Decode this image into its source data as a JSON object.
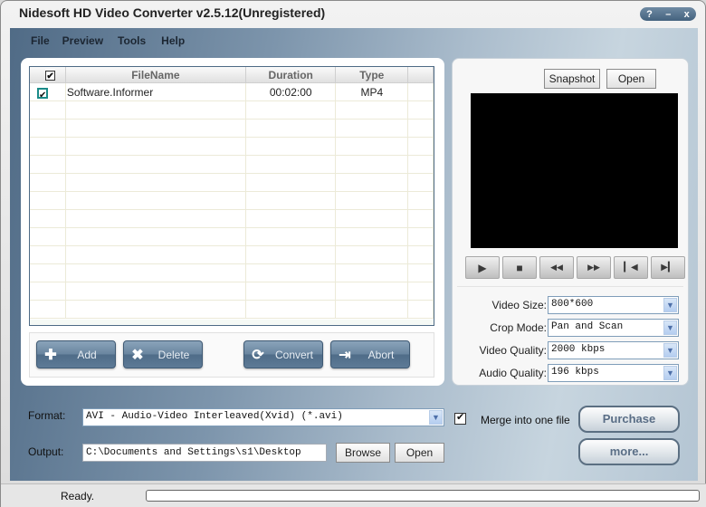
{
  "window": {
    "title": "Nidesoft HD Video Converter v2.5.12(Unregistered)",
    "controls": [
      {
        "name": "help-button",
        "label": "?"
      },
      {
        "name": "minimize-button",
        "label": "–"
      },
      {
        "name": "close-button",
        "label": "x"
      }
    ]
  },
  "menu": [
    {
      "label": "File"
    },
    {
      "label": "Preview"
    },
    {
      "label": "Tools"
    },
    {
      "label": "Help"
    }
  ],
  "file_list": {
    "header_checked": true,
    "columns": [
      "FileName",
      "Duration",
      "Type"
    ],
    "rows": [
      {
        "checked": true,
        "filename": "Software.Informer",
        "duration": "00:02:00",
        "type": "MP4"
      }
    ],
    "empty_rows": 12
  },
  "actions": {
    "add": {
      "label": "Add",
      "icon": "plus-icon"
    },
    "delete": {
      "label": "Delete",
      "icon": "x-cross-icon"
    },
    "convert": {
      "label": "Convert",
      "icon": "refresh-icon"
    },
    "abort": {
      "label": "Abort",
      "icon": "exit-arrow-icon"
    }
  },
  "preview": {
    "snapshot_label": "Snapshot",
    "open_label": "Open",
    "controls": [
      {
        "name": "play-button",
        "icon": "play-icon",
        "glyph": "▶"
      },
      {
        "name": "stop-button",
        "icon": "stop-icon",
        "glyph": "■"
      },
      {
        "name": "rewind-button",
        "icon": "rewind-icon",
        "glyph": "◀◀"
      },
      {
        "name": "fast-forward-button",
        "icon": "fast-forward-icon",
        "glyph": "▶▶"
      },
      {
        "name": "previous-button",
        "icon": "skip-back-icon",
        "glyph": "▎◀"
      },
      {
        "name": "next-button",
        "icon": "skip-forward-icon",
        "glyph": "▶▎"
      }
    ]
  },
  "settings": {
    "video_size": {
      "label": "Video Size:",
      "value": "800*600"
    },
    "crop_mode": {
      "label": "Crop Mode:",
      "value": "Pan and Scan"
    },
    "video_quality": {
      "label": "Video Quality:",
      "value": "2000 kbps"
    },
    "audio_quality": {
      "label": "Audio Quality:",
      "value": "196 kbps"
    }
  },
  "output": {
    "format_label": "Format:",
    "format_value": "AVI - Audio-Video Interleaved(Xvid) (*.avi)",
    "output_label": "Output:",
    "output_path": "C:\\Documents and Settings\\s1\\Desktop",
    "browse_label": "Browse",
    "open_label": "Open",
    "merge_label": "Merge into one file",
    "merge_checked": true,
    "purchase_label": "Purchase",
    "more_label": "more..."
  },
  "status": {
    "text": "Ready.",
    "progress": 0
  }
}
